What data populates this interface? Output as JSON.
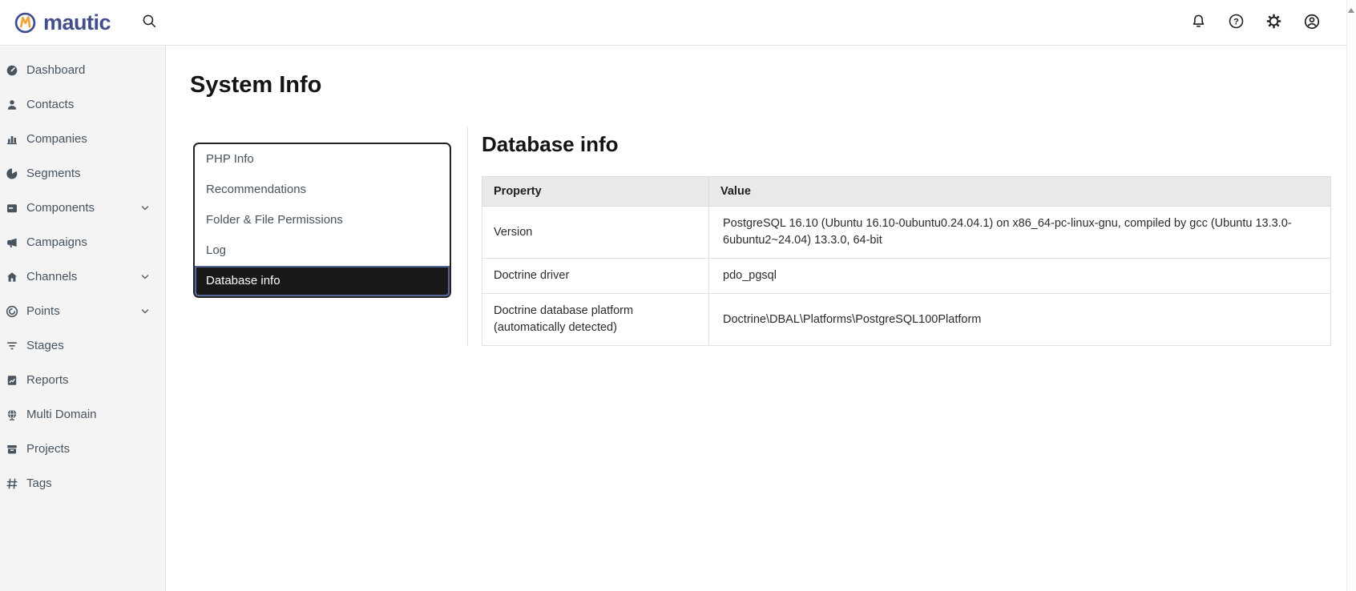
{
  "topbar": {
    "logo_text": "mautic",
    "search_icon": "search",
    "right_icons": [
      {
        "icon": "notifications",
        "label": "Notifications"
      },
      {
        "icon": "help",
        "label": "Help"
      },
      {
        "icon": "settings",
        "label": "Settings"
      },
      {
        "icon": "account",
        "label": "Account"
      }
    ]
  },
  "sidebar": {
    "items": [
      {
        "label": "Dashboard",
        "icon": "dashboard",
        "expandable": false
      },
      {
        "label": "Contacts",
        "icon": "contacts",
        "expandable": false
      },
      {
        "label": "Companies",
        "icon": "companies",
        "expandable": false
      },
      {
        "label": "Segments",
        "icon": "segments",
        "expandable": false
      },
      {
        "label": "Components",
        "icon": "components",
        "expandable": true
      },
      {
        "label": "Campaigns",
        "icon": "campaigns",
        "expandable": false
      },
      {
        "label": "Channels",
        "icon": "channels",
        "expandable": true
      },
      {
        "label": "Points",
        "icon": "points",
        "expandable": true
      },
      {
        "label": "Stages",
        "icon": "stages",
        "expandable": false
      },
      {
        "label": "Reports",
        "icon": "reports",
        "expandable": false
      },
      {
        "label": "Multi Domain",
        "icon": "multidomain",
        "expandable": false
      },
      {
        "label": "Projects",
        "icon": "projects",
        "expandable": false
      },
      {
        "label": "Tags",
        "icon": "tags",
        "expandable": false
      }
    ]
  },
  "page": {
    "title": "System Info"
  },
  "tabs": {
    "items": [
      {
        "label": "PHP Info",
        "active": false
      },
      {
        "label": "Recommendations",
        "active": false
      },
      {
        "label": "Folder & File Permissions",
        "active": false
      },
      {
        "label": "Log",
        "active": false
      },
      {
        "label": "Database info",
        "active": true
      }
    ]
  },
  "content": {
    "heading": "Database info",
    "table": {
      "columns": [
        "Property",
        "Value"
      ],
      "rows": [
        {
          "property": "Version",
          "value": "PostgreSQL 16.10 (Ubuntu 16.10-0ubuntu0.24.04.1) on x86_64-pc-linux-gnu, compiled by gcc (Ubuntu 13.3.0-6ubuntu2~24.04) 13.3.0, 64-bit"
        },
        {
          "property": "Doctrine driver",
          "value": "pdo_pgsql"
        },
        {
          "property": "Doctrine database platform (automatically detected)",
          "value": "Doctrine\\DBAL\\Platforms\\PostgreSQL100Platform"
        }
      ]
    }
  },
  "colors": {
    "brand_indigo": "#434f8c",
    "accent_orange": "#f2a33c",
    "active_tab_bg": "#191919",
    "active_tab_border": "#56659c",
    "sidebar_bg": "#f4f4f4",
    "table_header_bg": "#e9e9e9"
  }
}
